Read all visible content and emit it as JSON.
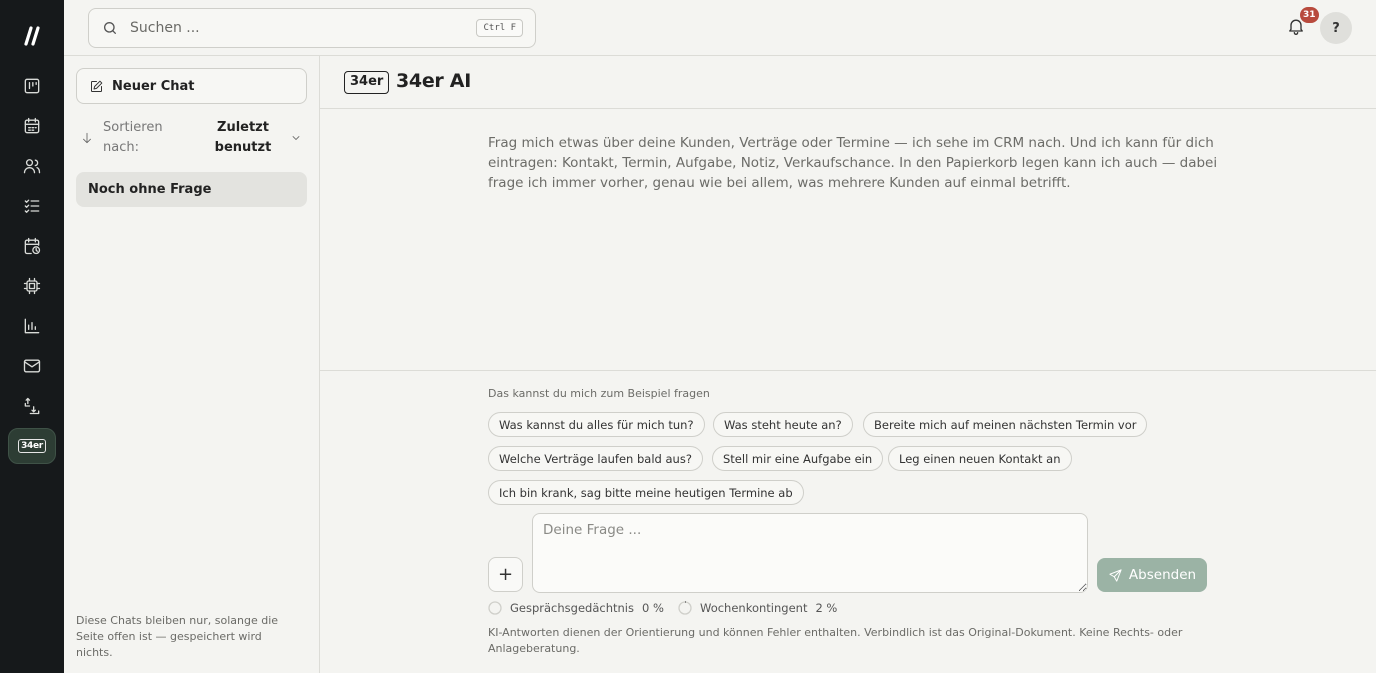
{
  "rail": {
    "logo_icon": "app-logo",
    "items": [
      {
        "name": "kanban-icon"
      },
      {
        "name": "calendar-icon"
      },
      {
        "name": "contacts-icon"
      },
      {
        "name": "tasks-icon"
      },
      {
        "name": "schedule-icon"
      },
      {
        "name": "chip-icon"
      },
      {
        "name": "reports-icon"
      },
      {
        "name": "mail-icon"
      },
      {
        "name": "import-export-icon"
      }
    ],
    "active_label": "34er"
  },
  "topbar": {
    "search_placeholder": "Suchen ...",
    "search_shortcut": "Ctrl F",
    "notification_count": "31",
    "help_label": "?"
  },
  "sidebar": {
    "new_chat_label": "Neuer Chat",
    "sort_label": "Sortieren nach:",
    "sort_value": "Zuletzt benutzt",
    "chats": [
      "Noch ohne Frage"
    ],
    "note": "Diese Chats bleiben nur, solange die Seite offen ist — gespeichert wird nichts."
  },
  "main": {
    "tag": "34er",
    "title": "34er AI",
    "intro": "Frag mich etwas über deine Kunden, Verträge oder Termine — ich sehe im CRM nach. Und ich kann für dich eintragen: Kontakt, Termin, Aufgabe, Notiz, Verkaufschance. In den Papierkorb legen kann ich auch — dabei frage ich immer vorher, genau wie bei allem, was mehrere Kunden auf einmal betrifft.",
    "suggestions_title": "Das kannst du mich zum Beispiel fragen",
    "suggestions": [
      "Was kannst du alles für mich tun?",
      "Was steht heute an?",
      "Bereite mich auf meinen nächsten Termin vor",
      "Welche Verträge laufen bald aus?",
      "Stell mir eine Aufgabe ein",
      "Leg einen neuen Kontakt an",
      "Ich bin krank, sag bitte meine heutigen Termine ab"
    ],
    "input_placeholder": "Deine Frage ...",
    "plus_label": "+",
    "send_label": "Absenden",
    "memory_label": "Gesprächsgedächtnis",
    "memory_value": "0 %",
    "memory_fraction": 0.0,
    "quota_label": "Wochenkontingent",
    "quota_value": "2 %",
    "quota_fraction": 0.02,
    "disclaimer": "KI-Antworten dienen der Orientierung und können Fehler enthalten. Verbindlich ist das Original-Dokument. Keine Rechts- oder Anlageberatung."
  },
  "colors": {
    "rail_bg": "#16191b",
    "accent_green": "#9bb3a5",
    "badge_red": "#b84a3d"
  }
}
